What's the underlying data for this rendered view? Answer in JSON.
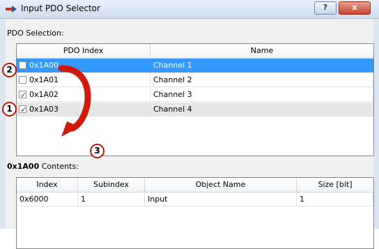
{
  "window": {
    "title": "Input PDO Selector",
    "help": "?",
    "close": "x"
  },
  "pdo_selection": {
    "label": "PDO Selection:",
    "columns": [
      "PDO Index",
      "Name"
    ],
    "rows": [
      {
        "checked": false,
        "index": "0x1A00",
        "name": "Channel 1",
        "selected": true
      },
      {
        "checked": false,
        "index": "0x1A01",
        "name": "Channel 2",
        "selected": false
      },
      {
        "checked": true,
        "index": "0x1A02",
        "name": "Channel 3",
        "selected": false
      },
      {
        "checked": true,
        "index": "0x1A03",
        "name": "Channel 4",
        "selected": false
      }
    ]
  },
  "contents": {
    "label_bold": "0x1A00",
    "label_rest": " Contents:",
    "columns": [
      "Index",
      "Subindex",
      "Object Name",
      "Size [bit]"
    ],
    "rows": [
      {
        "index": "0x6000",
        "subindex": "1",
        "object_name": "Input",
        "size": "1"
      }
    ]
  },
  "callouts": {
    "one": "1",
    "two": "2",
    "three": "3"
  },
  "colors": {
    "selection": "#3399ff",
    "callout": "#c41200"
  }
}
